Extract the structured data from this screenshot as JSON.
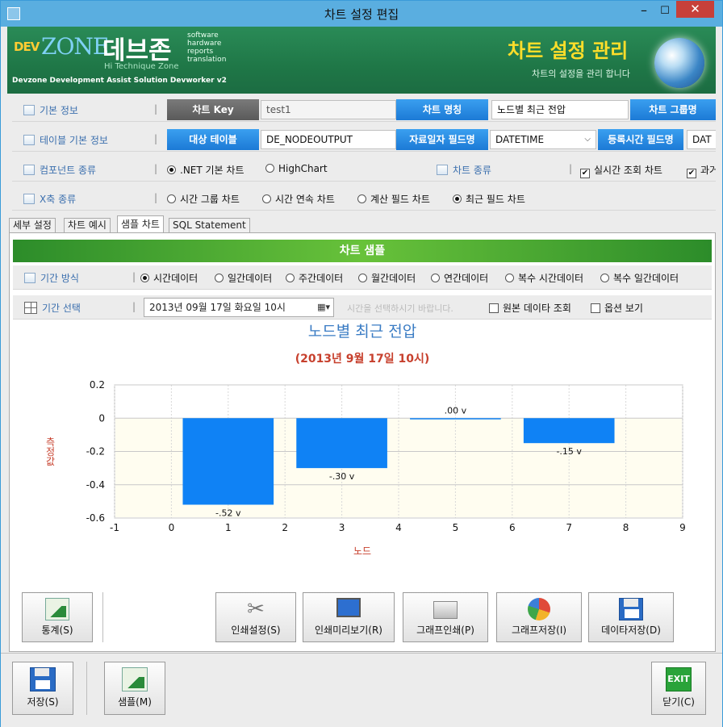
{
  "window": {
    "title": "차트 설정 편집",
    "min_glyph": "–",
    "max_glyph": "☐",
    "close_glyph": "✕"
  },
  "banner": {
    "logo_dev": "DEV",
    "logo_zone": "ZONE",
    "logo_kr": "데브존",
    "logo_sub": "Hi Technique Zone",
    "logo_words": [
      "software",
      "hardware",
      "reports",
      "translation"
    ],
    "tagline": "Devzone Development Assist Solution Devworker v2",
    "title": "차트 설정 관리",
    "subtitle": "차트의 설정을 관리 합니다"
  },
  "basic_info": {
    "label": "기본 정보",
    "chart_key_label": "차트 Key",
    "chart_key_value": "test1",
    "chart_name_label": "차트 명칭",
    "chart_name_value": "노드별 최근 전압",
    "chart_group_label": "차트 그룹명"
  },
  "table_info": {
    "label": "테이블 기본 정보",
    "target_table_label": "대상 테이블",
    "target_table_value": "DE_NODEOUTPUT",
    "date_field_label": "자료일자 필드명",
    "date_field_value": "DATETIME",
    "reg_time_label": "등록시간 필드명",
    "reg_time_value": "DAT"
  },
  "component": {
    "label": "컴포넌트 종류",
    "options": [
      {
        "label": ".NET 기본 차트",
        "selected": true
      },
      {
        "label": "HighChart",
        "selected": false
      }
    ],
    "chart_type_label": "차트 종류",
    "checks": [
      {
        "label": "실시간 조회 차트",
        "checked": true
      },
      {
        "label": "과거",
        "checked": true
      }
    ]
  },
  "xaxis": {
    "label": "X축 종류",
    "options": [
      {
        "label": "시간 그룹 차트",
        "selected": false
      },
      {
        "label": "시간 연속 차트",
        "selected": false
      },
      {
        "label": "계산 필드 차트",
        "selected": false
      },
      {
        "label": "최근 필드 차트",
        "selected": true
      }
    ]
  },
  "tabs": [
    {
      "label": "세부 설정",
      "active": false
    },
    {
      "label": "차트 예시",
      "active": false
    },
    {
      "label": "샘플 차트",
      "active": true
    },
    {
      "label": "SQL Statement",
      "active": false
    }
  ],
  "sample": {
    "header": "차트 샘플",
    "period_label": "기간 방식",
    "period_options": [
      {
        "label": "시간데이터",
        "selected": true
      },
      {
        "label": "일간데이터",
        "selected": false
      },
      {
        "label": "주간데이터",
        "selected": false
      },
      {
        "label": "월간데이터",
        "selected": false
      },
      {
        "label": "연간데이터",
        "selected": false
      },
      {
        "label": "복수 시간데이터",
        "selected": false
      },
      {
        "label": "복수 일간데이터",
        "selected": false
      }
    ],
    "range_label": "기간 선택",
    "date_value": "2013년 09월 17일 화요일 10시",
    "hint": "시간을 선택하시기 바랍니다.",
    "check_raw": "원본 데이타 조회",
    "check_options": "옵션 보기"
  },
  "chart_data": {
    "type": "bar",
    "title": "노드별 최근 전압",
    "subtitle": "(2013년 9월 17일 10시)",
    "xlabel": "노드",
    "ylabel": "측정값",
    "xlim": [
      -1,
      9
    ],
    "ylim": [
      -0.6,
      0.2
    ],
    "x_ticks": [
      -1,
      0,
      1,
      2,
      3,
      4,
      5,
      6,
      7,
      8,
      9
    ],
    "y_ticks": [
      "0.2",
      "0",
      "-0.2",
      "-0.4",
      "-0.6"
    ],
    "grid": true,
    "x": [
      1,
      3,
      5,
      7
    ],
    "values": [
      -0.52,
      -0.3,
      0.0,
      -0.15
    ],
    "data_labels": [
      "-.52 v",
      "-.30 v",
      ".00 v",
      "-.15 v"
    ],
    "bar_color": "#0f82f5"
  },
  "toolbar": {
    "stats": "통계(S)",
    "print_setup": "인쇄설정(S)",
    "print_preview": "인쇄미리보기(R)",
    "graph_print": "그래프인쇄(P)",
    "graph_save": "그래프저장(I)",
    "data_save": "데이타저장(D)"
  },
  "footer": {
    "save": "저장(S)",
    "sample": "샘플(M)",
    "exit_icon": "EXIT",
    "close": "닫기(C)"
  }
}
